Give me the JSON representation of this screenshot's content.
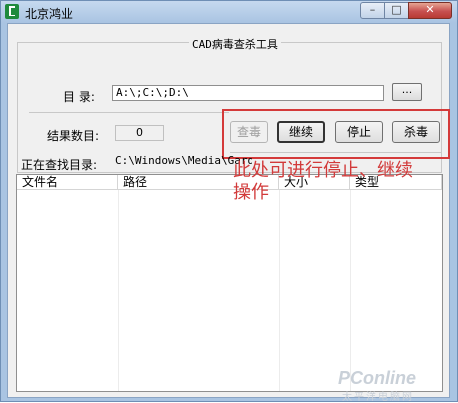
{
  "window": {
    "title": "北京鸿业",
    "controls": {
      "minimize": "–",
      "maximize": "□",
      "close": "✕"
    }
  },
  "group": {
    "title": "CAD病毒查杀工具"
  },
  "directory": {
    "label": "目 录:",
    "value": "A:\\;C:\\;D:\\",
    "browse_label": "..."
  },
  "results": {
    "label": "结果数目:",
    "count": "0"
  },
  "searching": {
    "label": "正在查找目录:",
    "path": "C:\\Windows\\Media\\Garden"
  },
  "buttons": {
    "scan": "查毒",
    "continue": "继续",
    "stop": "停止",
    "kill": "杀毒"
  },
  "list": {
    "columns": [
      "文件名",
      "路径",
      "大小",
      "类型"
    ]
  },
  "annotation": {
    "line1": "此处可进行停止、继续",
    "line2": "操作"
  },
  "watermark": {
    "brand": "PConline",
    "sub": "太平洋电脑网"
  },
  "colors": {
    "accent_red": "#d43a3a",
    "title_bar": "#a9c4e2"
  }
}
